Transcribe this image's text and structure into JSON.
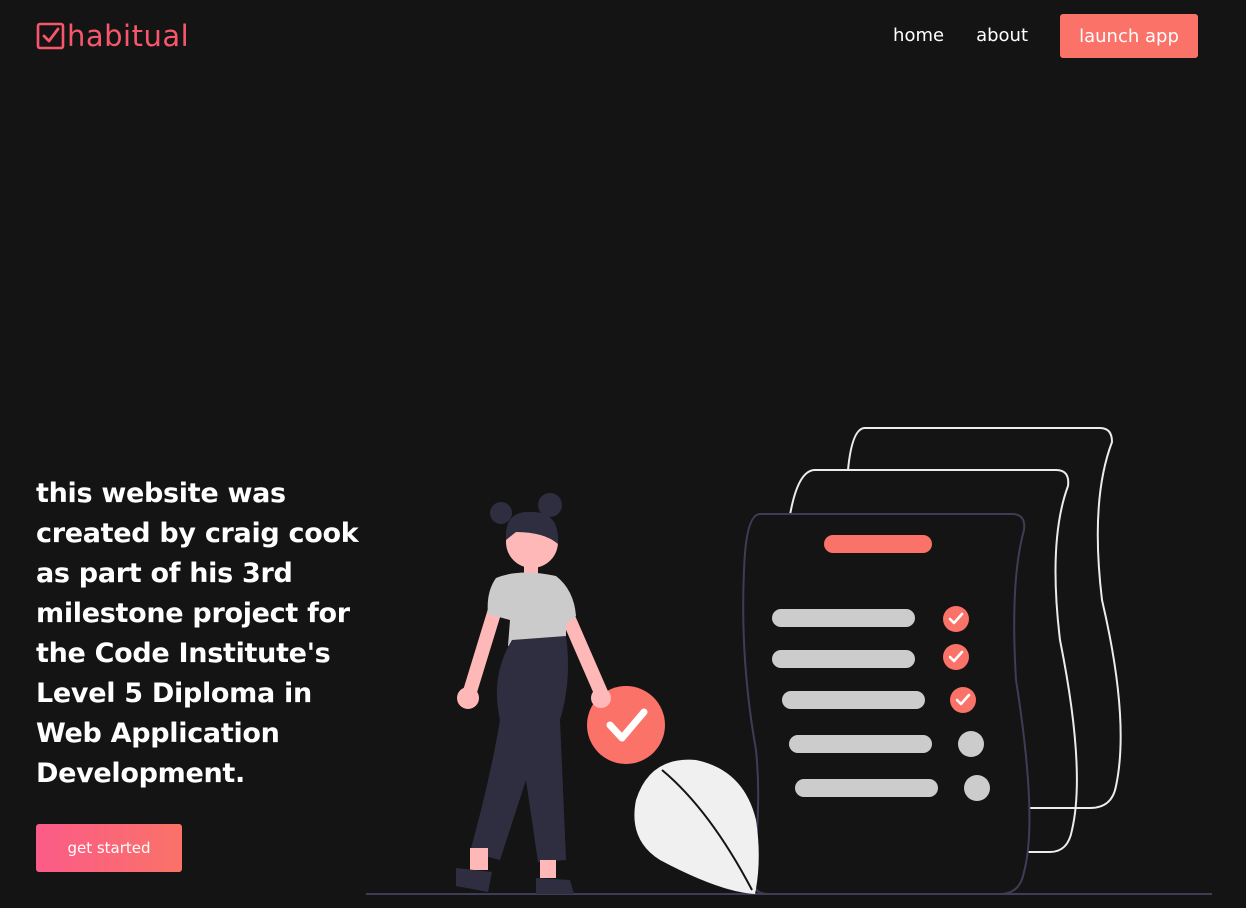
{
  "header": {
    "logo_text": "habitual",
    "nav": {
      "home_label": "home",
      "about_label": "about",
      "launch_label": "launch app"
    }
  },
  "hero": {
    "description": "this website was created by craig cook as part of his 3rd milestone project for the Code Institute's Level 5 Diploma in Web Application Development.",
    "cta_label": "get started"
  },
  "illustration": {
    "name": "woman-with-checklist-illustration",
    "checklist": {
      "items": [
        {
          "checked": true
        },
        {
          "checked": true
        },
        {
          "checked": true
        },
        {
          "checked": false
        },
        {
          "checked": false
        }
      ]
    }
  },
  "colors": {
    "background": "#141414",
    "brand": "#f8576b",
    "accent": "#fa7268",
    "cta_gradient_start": "#fb5b88",
    "cta_gradient_end": "#fa7268",
    "text": "#ffffff"
  }
}
